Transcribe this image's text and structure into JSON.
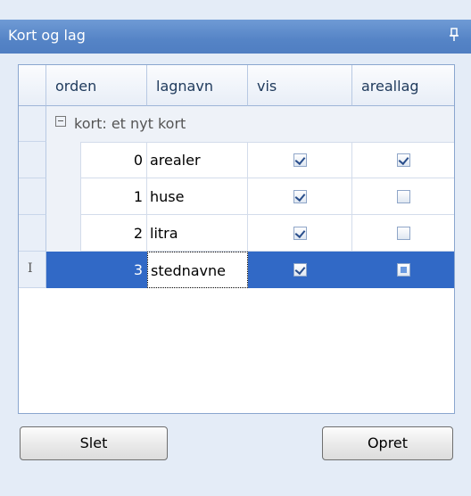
{
  "window": {
    "title": "Kort og lag"
  },
  "columns": [
    "orden",
    "lagnavn",
    "vis",
    "areallag"
  ],
  "group": {
    "label": "kort: et nyt kort"
  },
  "rows": [
    {
      "orden": "0",
      "lagnavn": "arealer",
      "vis": true,
      "areallag": true
    },
    {
      "orden": "1",
      "lagnavn": "huse",
      "vis": true,
      "areallag": false
    },
    {
      "orden": "2",
      "lagnavn": "litra",
      "vis": true,
      "areallag": false
    },
    {
      "orden": "3",
      "lagnavn": "stednavne",
      "vis": true,
      "areallag": false
    }
  ],
  "selected_row": 3,
  "buttons": {
    "delete": "Slet",
    "create": "Opret"
  },
  "colors": {
    "titlebar": "#5584c6",
    "selection": "#3169c6",
    "panel": "#e4ecf7"
  }
}
